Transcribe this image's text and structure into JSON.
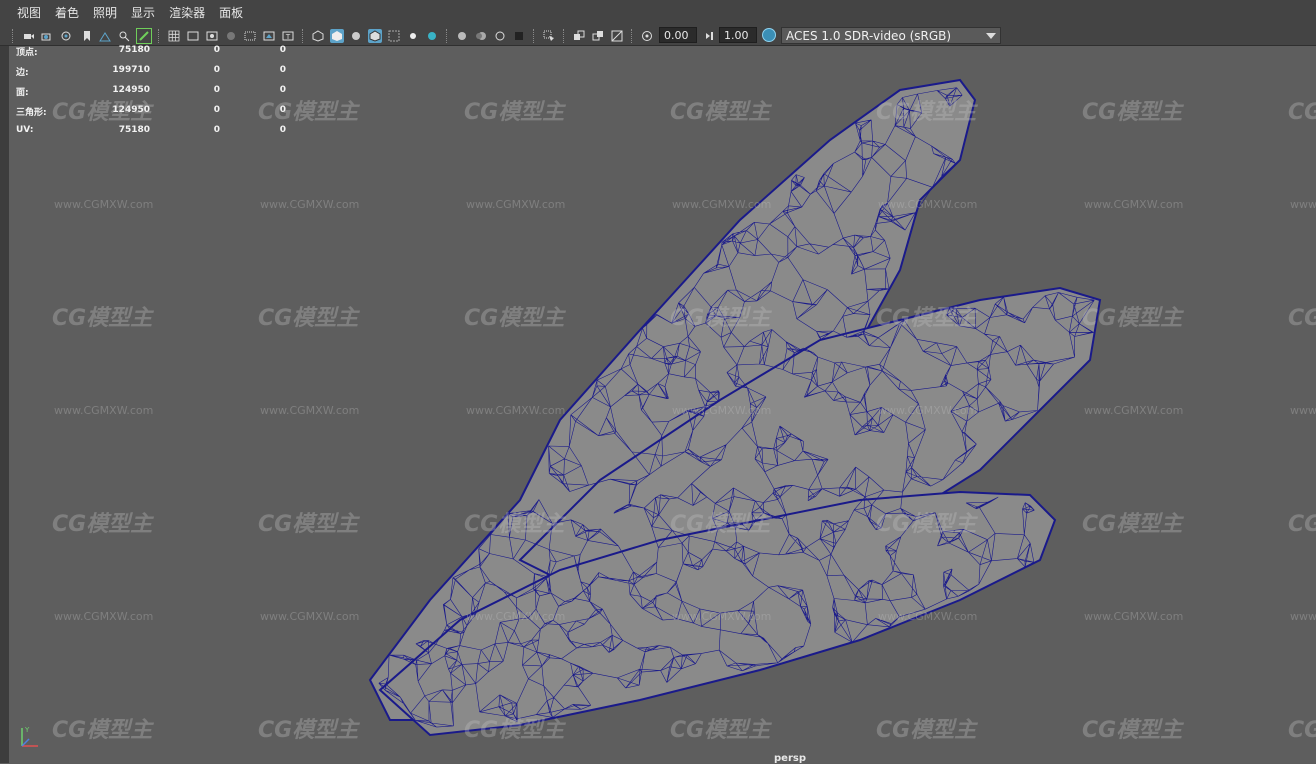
{
  "menu": {
    "items": [
      "视图",
      "着色",
      "照明",
      "显示",
      "渲染器",
      "面板"
    ]
  },
  "toolbar": {
    "exposure_value": "0.00",
    "gamma_value": "1.00",
    "color_space": "ACES 1.0 SDR-video (sRGB)",
    "icons": [
      "select-camera-icon",
      "camera-attributes-icon",
      "bookmark-icon",
      "image-plane-icon",
      "2d-pan-zoom-icon",
      "grease-pencil-icon",
      "grid-icon",
      "film-gate-icon",
      "resolution-gate-icon",
      "gate-mask-icon",
      "field-chart-icon",
      "safe-action-icon",
      "safe-title-icon",
      "wireframe-icon",
      "smooth-shade-icon",
      "default-material-icon",
      "wireframe-on-shaded-icon",
      "xray-icon",
      "textured-icon",
      "use-all-lights-icon",
      "shadows-icon",
      "screen-space-ao-icon",
      "motion-blur-icon",
      "multisample-aa-icon",
      "depth-of-field-icon",
      "isolate-select-icon",
      "xray-joints-icon",
      "xray-active-components-icon",
      "backface-culling-icon",
      "exposure-icon",
      "gamma-icon",
      "color-management-icon"
    ],
    "accent_active": "#5da3c9"
  },
  "hud": {
    "rows": [
      {
        "label": "顶点:",
        "value": "75180",
        "selected": "0",
        "triangles": "0"
      },
      {
        "label": "边:",
        "value": "199710",
        "selected": "0",
        "triangles": "0"
      },
      {
        "label": "面:",
        "value": "124950",
        "selected": "0",
        "triangles": "0"
      },
      {
        "label": "三角形:",
        "value": "124950",
        "selected": "0",
        "triangles": "0"
      },
      {
        "label": "UV:",
        "value": "75180",
        "selected": "0",
        "triangles": "0"
      }
    ]
  },
  "viewport": {
    "camera": "persp",
    "wire_color": "#1a1a8a",
    "mesh_color": "#8a8a8a",
    "background": "#5e5e5e"
  },
  "watermark": {
    "logo_text": "CG模型主",
    "url_text": "www.CGMXW.com"
  }
}
